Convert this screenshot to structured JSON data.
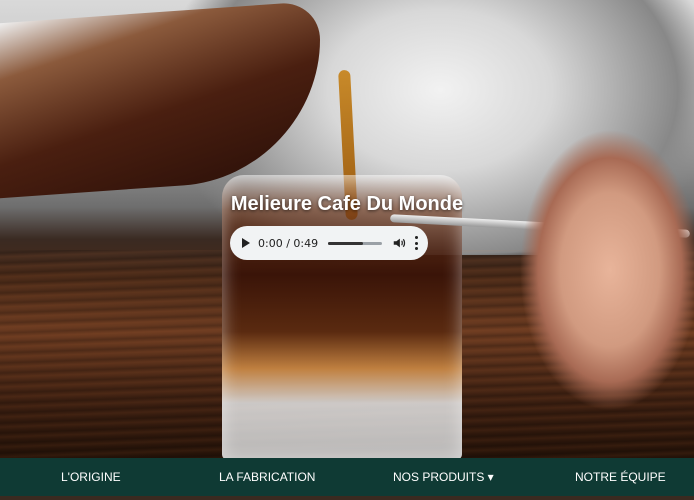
{
  "hero": {
    "title": "Melieure Cafe Du Monde"
  },
  "audio_player": {
    "time_display": "0:00 / 0:49",
    "progress_fraction": 0.0,
    "volume_fraction": 0.65,
    "play_icon": "play-icon",
    "volume_icon": "volume-icon",
    "menu_icon": "more-vertical-icon"
  },
  "nav": {
    "items": [
      {
        "label": "L'ORIGINE"
      },
      {
        "label": "LA FABRICATION"
      },
      {
        "label": "NOS PRODUITS ▾"
      },
      {
        "label": "NOTRE ÉQUIPE"
      }
    ],
    "background_color": "#0f3a34"
  }
}
